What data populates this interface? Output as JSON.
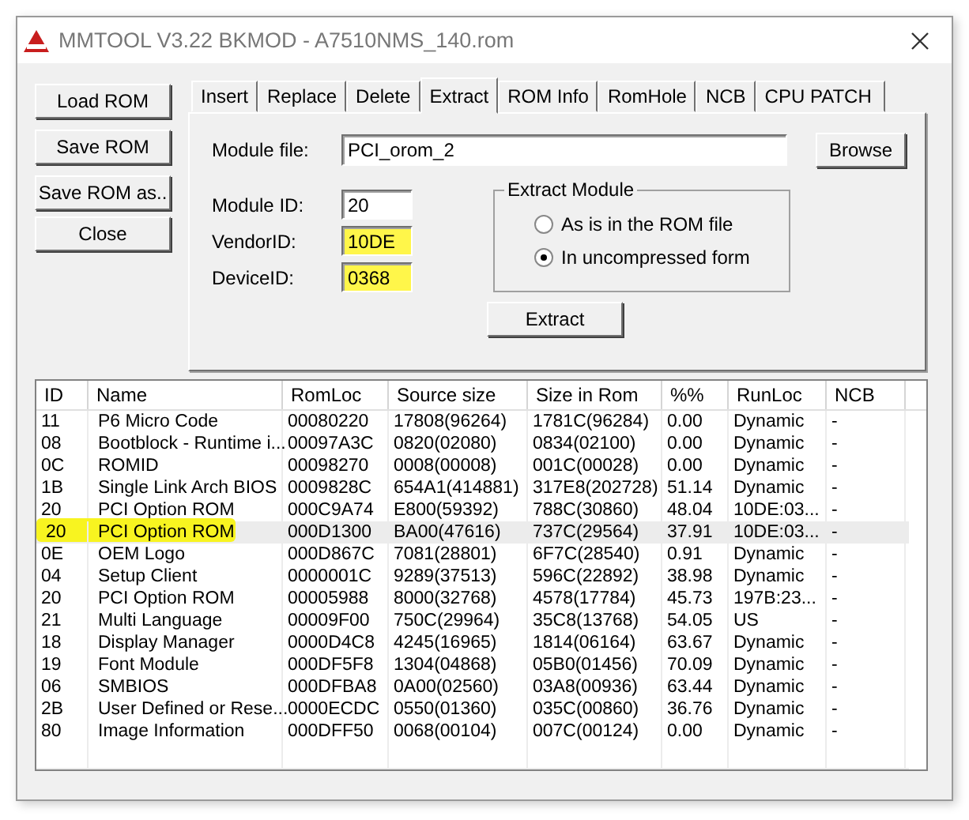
{
  "window": {
    "title": "MMTOOL V3.22 BKMOD - A7510NMS_140.rom"
  },
  "side_buttons": [
    "Load ROM",
    "Save ROM",
    "Save ROM as..",
    "Close"
  ],
  "tabs": [
    {
      "label": "Insert",
      "selected": false
    },
    {
      "label": "Replace",
      "selected": false
    },
    {
      "label": "Delete",
      "selected": false
    },
    {
      "label": "Extract",
      "selected": true
    },
    {
      "label": "ROM Info",
      "selected": false
    },
    {
      "label": "RomHole",
      "selected": false
    },
    {
      "label": "NCB",
      "selected": false
    },
    {
      "label": "CPU PATCH",
      "selected": false
    }
  ],
  "module_file": {
    "label": "Module file:",
    "value": "PCI_orom_2",
    "button": "Browse"
  },
  "fields": [
    {
      "label": "Module ID:",
      "value": "20",
      "marked": false
    },
    {
      "label": "VendorID:",
      "value": "10DE",
      "marked": true
    },
    {
      "label": "DeviceID:",
      "value": "0368",
      "marked": true
    }
  ],
  "extract_module": {
    "title": "Extract Module",
    "options": [
      {
        "label": "As is in the ROM file",
        "selected": false
      },
      {
        "label": "In uncompressed form",
        "selected": true
      }
    ]
  },
  "extract_button": "Extract",
  "table": {
    "columns": [
      "ID",
      "Name",
      "RomLoc",
      "Source size",
      "Size in Rom",
      "%%",
      "RunLoc",
      "NCB"
    ],
    "rows": [
      {
        "cells": [
          "11",
          "P6 Micro Code",
          "00080220",
          "17808(96264)",
          "1781C(96284)",
          "0.00",
          "Dynamic",
          "-"
        ],
        "selected": false,
        "marked": false
      },
      {
        "cells": [
          "08",
          "Bootblock - Runtime i...",
          "00097A3C",
          "0820(02080)",
          "0834(02100)",
          "0.00",
          "Dynamic",
          "-"
        ],
        "selected": false,
        "marked": false
      },
      {
        "cells": [
          "0C",
          "ROMID",
          "00098270",
          "0008(00008)",
          "001C(00028)",
          "0.00",
          "Dynamic",
          "-"
        ],
        "selected": false,
        "marked": false
      },
      {
        "cells": [
          "1B",
          "Single Link Arch BIOS",
          "0009828C",
          "654A1(414881)",
          "317E8(202728)",
          "51.14",
          "Dynamic",
          "-"
        ],
        "selected": false,
        "marked": false
      },
      {
        "cells": [
          "20",
          "PCI Option ROM",
          "000C9A74",
          "E800(59392)",
          "788C(30860)",
          "48.04",
          "10DE:03...",
          "-"
        ],
        "selected": false,
        "marked": false
      },
      {
        "cells": [
          "20",
          "PCI Option ROM",
          "000D1300",
          "BA00(47616)",
          "737C(29564)",
          "37.91",
          "10DE:03...",
          "-"
        ],
        "selected": true,
        "marked": true
      },
      {
        "cells": [
          "0E",
          "OEM Logo",
          "000D867C",
          "7081(28801)",
          "6F7C(28540)",
          "0.91",
          "Dynamic",
          "-"
        ],
        "selected": false,
        "marked": false
      },
      {
        "cells": [
          "04",
          "Setup Client",
          "0000001C",
          "9289(37513)",
          "596C(22892)",
          "38.98",
          "Dynamic",
          "-"
        ],
        "selected": false,
        "marked": false
      },
      {
        "cells": [
          "20",
          "PCI Option ROM",
          "00005988",
          "8000(32768)",
          "4578(17784)",
          "45.73",
          "197B:23...",
          "-"
        ],
        "selected": false,
        "marked": false
      },
      {
        "cells": [
          "21",
          "Multi Language",
          "00009F00",
          "750C(29964)",
          "35C8(13768)",
          "54.05",
          "US",
          "-"
        ],
        "selected": false,
        "marked": false
      },
      {
        "cells": [
          "18",
          "Display Manager",
          "0000D4C8",
          "4245(16965)",
          "1814(06164)",
          "63.67",
          "Dynamic",
          "-"
        ],
        "selected": false,
        "marked": false
      },
      {
        "cells": [
          "19",
          "Font Module",
          "000DF5F8",
          "1304(04868)",
          "05B0(01456)",
          "70.09",
          "Dynamic",
          "-"
        ],
        "selected": false,
        "marked": false
      },
      {
        "cells": [
          "06",
          "SMBIOS",
          "000DFBA8",
          "0A00(02560)",
          "03A8(00936)",
          "63.44",
          "Dynamic",
          "-"
        ],
        "selected": false,
        "marked": false
      },
      {
        "cells": [
          "2B",
          "User Defined or Rese...",
          "0000ECDC",
          "0550(01360)",
          "035C(00860)",
          "36.76",
          "Dynamic",
          "-"
        ],
        "selected": false,
        "marked": false
      },
      {
        "cells": [
          "80",
          "Image Information",
          "000DFF50",
          "0068(00104)",
          "007C(00124)",
          "0.00",
          "Dynamic",
          "-"
        ],
        "selected": false,
        "marked": false
      }
    ]
  }
}
